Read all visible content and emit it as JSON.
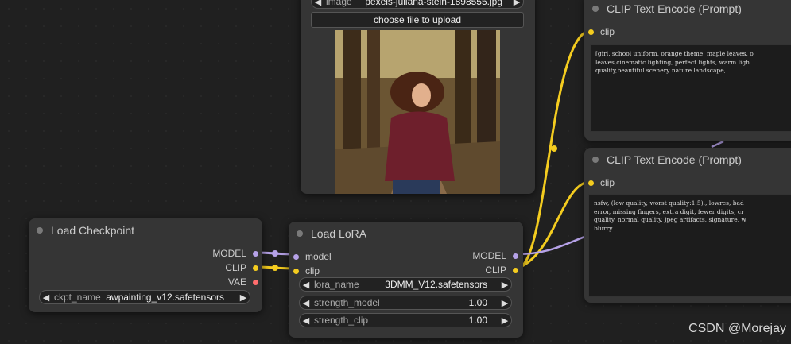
{
  "load_image": {
    "image_label": "image",
    "image_value": "pexels-juliana-stein-1898555.jpg",
    "upload_button": "choose file to upload"
  },
  "clip_top": {
    "title": "CLIP Text Encode (Prompt)",
    "input_label": "clip",
    "text": "[girl, school uniform, orange theme, maple leaves, o\nleaves,cinematic lighting, perfect lights, warm ligh\nquality,beautiful scenery nature landscape,"
  },
  "clip_bottom": {
    "title": "CLIP Text Encode (Prompt)",
    "input_label": "clip",
    "text": "nsfw, (low quality, worst quality:1.5),, lowres, bad\nerror, missing fingers, extra digit, fewer digits, cr\nquality, normal quality, jpeg artifacts, signature, w\nblurry"
  },
  "load_checkpoint": {
    "title": "Load Checkpoint",
    "outputs": [
      "MODEL",
      "CLIP",
      "VAE"
    ],
    "ckpt_label": "ckpt_name",
    "ckpt_value": "awpainting_v12.safetensors"
  },
  "load_lora": {
    "title": "Load LoRA",
    "inputs": [
      "model",
      "clip"
    ],
    "outputs": [
      "MODEL",
      "CLIP"
    ],
    "widgets": [
      {
        "label": "lora_name",
        "value": "3DMM_V12.safetensors"
      },
      {
        "label": "strength_model",
        "value": "1.00"
      },
      {
        "label": "strength_clip",
        "value": "1.00"
      }
    ]
  },
  "watermark": "CSDN @Morejay",
  "colors": {
    "model": "#b6a2e8",
    "clip": "#f4cc1f",
    "vae": "#ff6d6d"
  }
}
